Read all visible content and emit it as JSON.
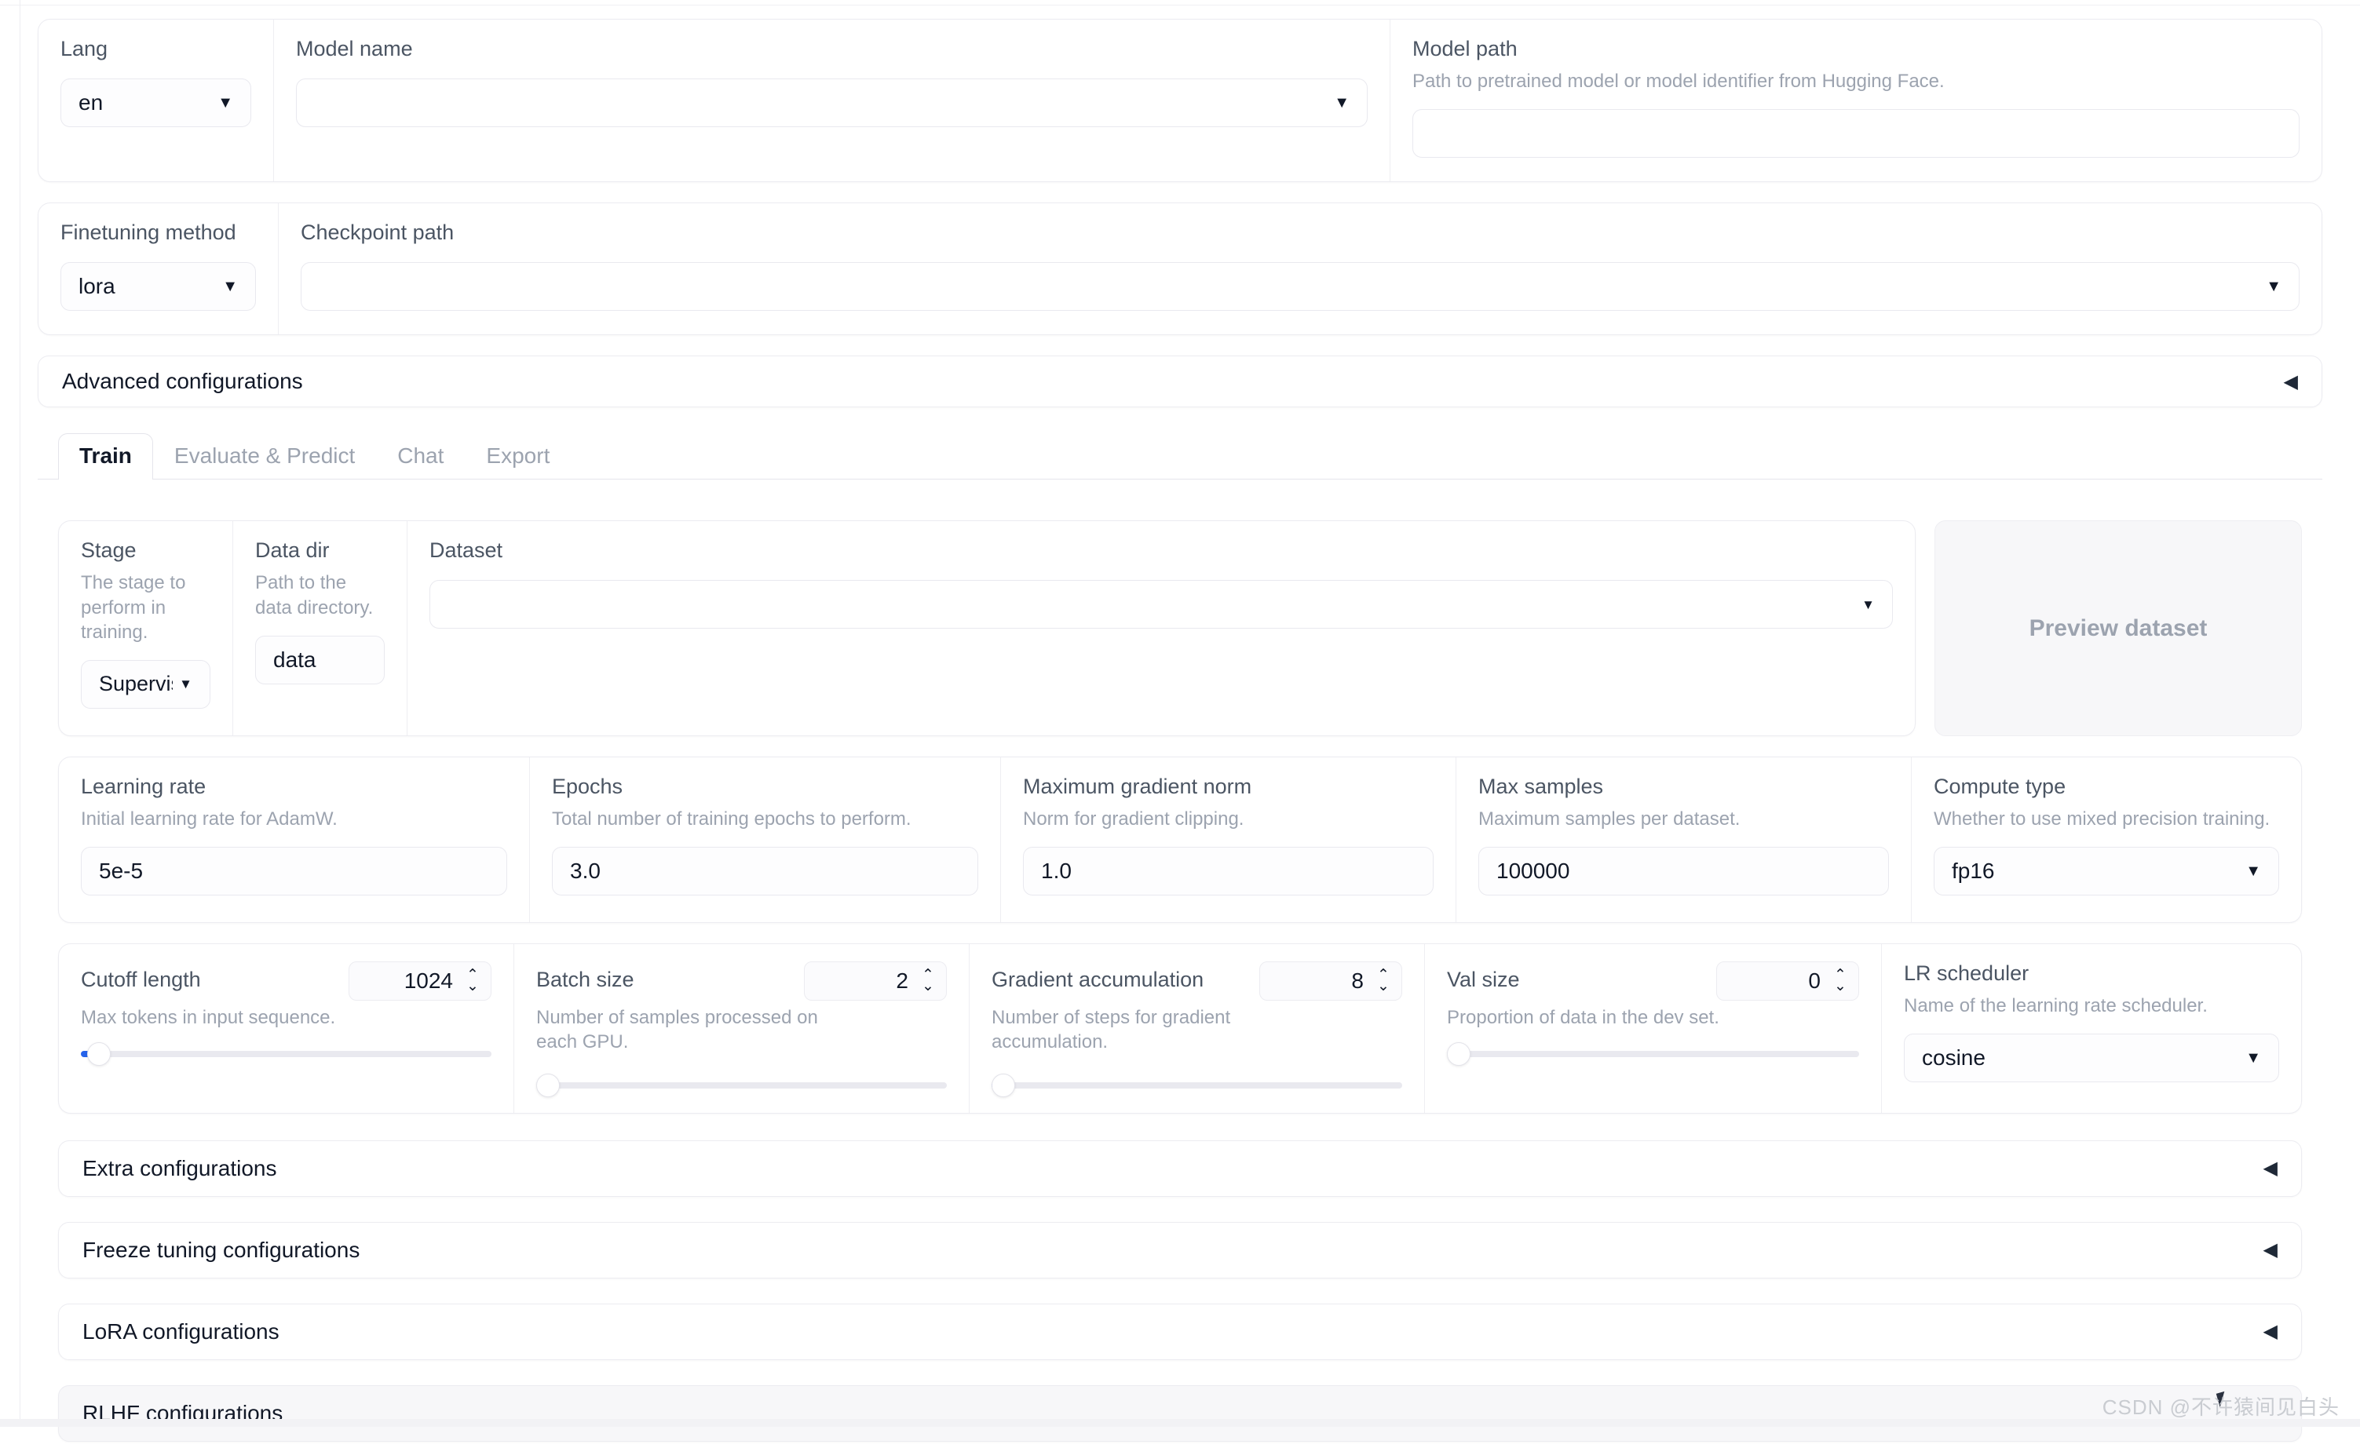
{
  "top_row": {
    "lang": {
      "label": "Lang",
      "value": "en",
      "caret": "chevron-down-icon"
    },
    "model_name": {
      "label": "Model name",
      "value": "",
      "caret": "chevron-down-icon"
    },
    "model_path": {
      "label": "Model path",
      "info": "Path to pretrained model or model identifier from Hugging Face.",
      "value": ""
    }
  },
  "method_row": {
    "finetuning_method": {
      "label": "Finetuning method",
      "value": "lora",
      "caret": "chevron-down-icon"
    },
    "checkpoint_path": {
      "label": "Checkpoint path",
      "value": "",
      "caret": "chevron-down-icon"
    }
  },
  "advanced": {
    "label": "Advanced configurations",
    "arrow": "triangle-left-icon"
  },
  "tabs": [
    {
      "label": "Train",
      "active": true
    },
    {
      "label": "Evaluate & Predict",
      "active": false
    },
    {
      "label": "Chat",
      "active": false
    },
    {
      "label": "Export",
      "active": false
    }
  ],
  "dataset_row": {
    "stage": {
      "label": "Stage",
      "info": "The stage to perform in training.",
      "value": "Supervised Fine-Tuning",
      "caret": "chevron-down-icon"
    },
    "data_dir": {
      "label": "Data dir",
      "info": "Path to the data directory.",
      "value": "data"
    },
    "dataset": {
      "label": "Dataset",
      "value": "",
      "caret": "chevron-down-icon"
    },
    "preview_button": "Preview dataset"
  },
  "params_row": [
    {
      "label": "Learning rate",
      "info": "Initial learning rate for AdamW.",
      "value": "5e-5",
      "type": "text"
    },
    {
      "label": "Epochs",
      "info": "Total number of training epochs to perform.",
      "value": "3.0",
      "type": "text"
    },
    {
      "label": "Maximum gradient norm",
      "info": "Norm for gradient clipping.",
      "value": "1.0",
      "type": "text"
    },
    {
      "label": "Max samples",
      "info": "Maximum samples per dataset.",
      "value": "100000",
      "type": "text"
    },
    {
      "label": "Compute type",
      "info": "Whether to use mixed precision training.",
      "value": "fp16",
      "type": "select"
    }
  ],
  "sliders_row": [
    {
      "label": "Cutoff length",
      "info": "Max tokens in input sequence.",
      "value": "1024",
      "fill_pct": 4,
      "knob_pct": 3
    },
    {
      "label": "Batch size",
      "info": "Number of samples processed on each GPU.",
      "value": "2",
      "fill_pct": 0,
      "knob_pct": 0
    },
    {
      "label": "Gradient accumulation",
      "info": "Number of steps for gradient accumulation.",
      "value": "8",
      "fill_pct": 1,
      "knob_pct": 0
    },
    {
      "label": "Val size",
      "info": "Proportion of data in the dev set.",
      "value": "0",
      "fill_pct": 0,
      "knob_pct": 0
    }
  ],
  "lr_scheduler": {
    "label": "LR scheduler",
    "info": "Name of the learning rate scheduler.",
    "value": "cosine",
    "caret": "chevron-down-icon"
  },
  "accordions": [
    {
      "label": "Extra configurations",
      "arrow": "triangle-left-icon",
      "shaded": false
    },
    {
      "label": "Freeze tuning configurations",
      "arrow": "triangle-left-icon",
      "shaded": false
    },
    {
      "label": "LoRA configurations",
      "arrow": "triangle-left-icon",
      "shaded": false
    },
    {
      "label": "RLHF configurations",
      "arrow": "",
      "shaded": true
    }
  ],
  "arrow_glyph": "◀",
  "caret_glyph": "▼",
  "spin_up_glyph": "⌃",
  "spin_down_glyph": "⌄",
  "watermark": "CSDN @不许猿间见白头",
  "colors": {
    "accent": "#2563eb",
    "label": "#4b5563",
    "muted": "#9ca3af",
    "border": "#ececf1"
  }
}
